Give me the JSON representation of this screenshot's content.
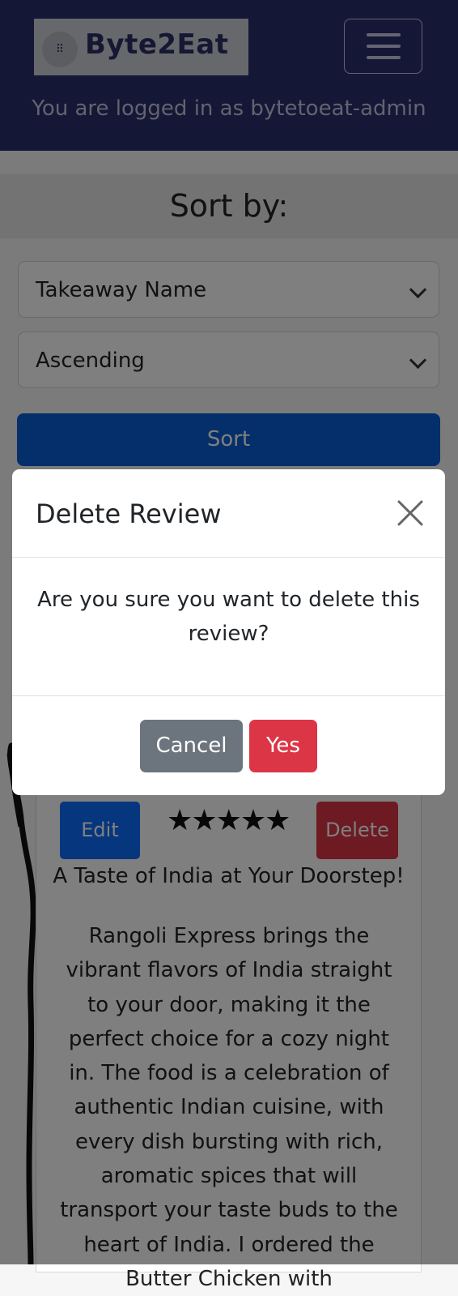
{
  "navbar": {
    "brand_name": "Byte2Eat",
    "login_status": "You are logged in as bytetoeat-admin"
  },
  "sort": {
    "heading": "Sort by:",
    "field_selected": "Takeaway Name",
    "order_selected": "Ascending",
    "button_label": "Sort"
  },
  "review": {
    "edit_label": "Edit",
    "delete_label": "Delete",
    "rating": 5,
    "title": "A Taste of India at Your Doorstep!",
    "body": "Rangoli Express brings the vibrant flavors of India straight to your door, making it the perfect choice for a cozy night in. The food is a celebration of authentic Indian cuisine, with every dish bursting with rich, aromatic spices that will transport your taste buds to the heart of India. I ordered the Butter Chicken with"
  },
  "modal": {
    "title": "Delete Review",
    "message": "Are you sure you want to delete this review?",
    "cancel_label": "Cancel",
    "confirm_label": "Yes"
  },
  "icons": {
    "menu": "hamburger-menu-icon",
    "close": "close-icon",
    "chevron": "chevron-down-icon",
    "star": "star-icon"
  },
  "colors": {
    "navbar": "#2b2f6e",
    "primary": "#0d6efd",
    "danger": "#dc3545",
    "secondary": "#6c757d"
  }
}
